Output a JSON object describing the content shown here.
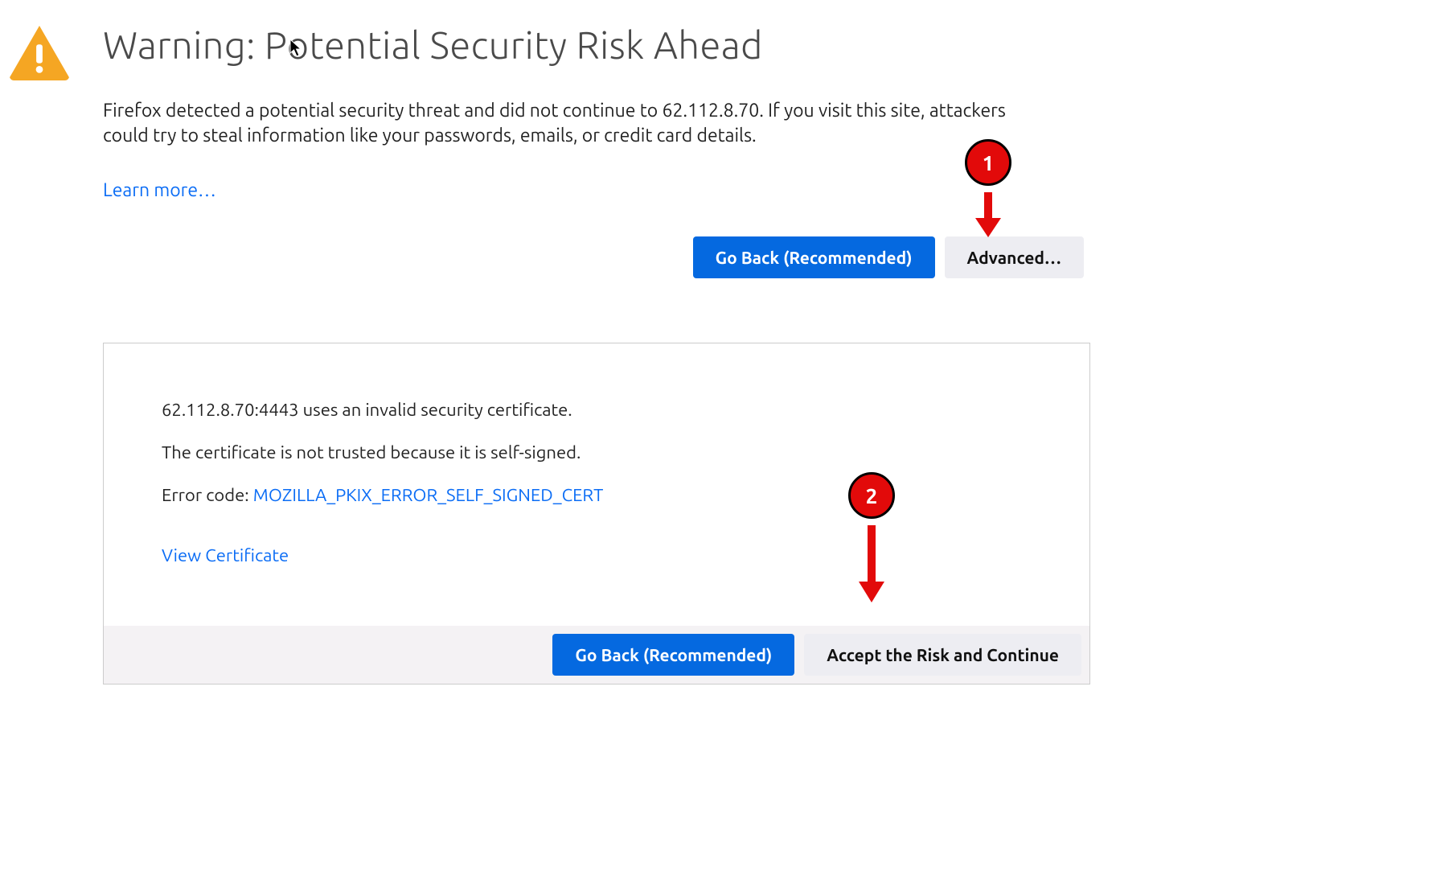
{
  "header": {
    "title": "Warning: Potential Security Risk Ahead"
  },
  "main": {
    "description": "Firefox detected a potential security threat and did not continue to 62.112.8.70. If you visit this site, attackers could try to steal information like your passwords, emails, or credit card details.",
    "learn_more_label": "Learn more…",
    "go_back_label": "Go Back (Recommended)",
    "advanced_label": "Advanced…"
  },
  "advanced_panel": {
    "invalid_cert_text": "62.112.8.70:4443 uses an invalid security certificate.",
    "not_trusted_text": "The certificate is not trusted because it is self-signed.",
    "error_code_prefix": "Error code: ",
    "error_code_value": "MOZILLA_PKIX_ERROR_SELF_SIGNED_CERT",
    "view_certificate_label": "View Certificate",
    "go_back_label": "Go Back (Recommended)",
    "accept_risk_label": "Accept the Risk and Continue"
  },
  "annotations": {
    "step1": "1",
    "step2": "2"
  }
}
